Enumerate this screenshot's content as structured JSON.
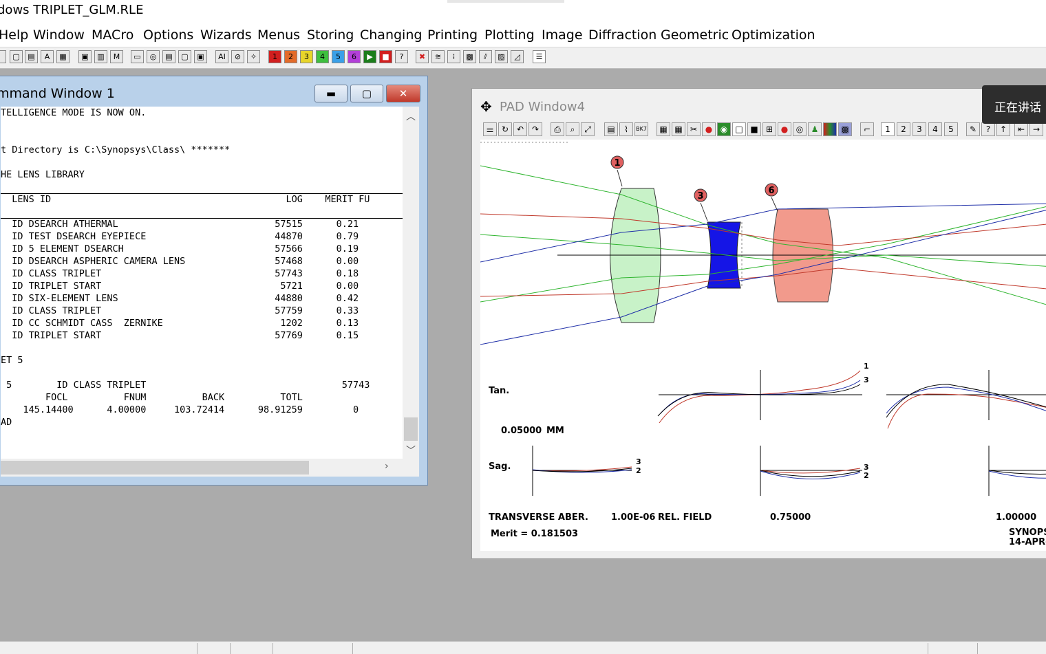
{
  "app": {
    "title": "dows TRIPLET_GLM.RLE"
  },
  "menu": [
    "Help",
    "Window",
    "MACro",
    "Options",
    "Wizards",
    "Menus",
    "Storing",
    "Changing",
    "Printing",
    "Plotting",
    "Image",
    "Diffraction",
    "Geometric",
    "Optimization"
  ],
  "toolbar": {
    "color_buttons": [
      {
        "label": "1",
        "color": "#d21f1f"
      },
      {
        "label": "2",
        "color": "#e36b2a"
      },
      {
        "label": "3",
        "color": "#e8d52a"
      },
      {
        "label": "4",
        "color": "#3fbf3f"
      },
      {
        "label": "5",
        "color": "#3aa0e8"
      },
      {
        "label": "6",
        "color": "#b33fd9"
      }
    ],
    "ai_label": "AI"
  },
  "command_window": {
    "title": "mmand Window 1",
    "lines": [
      "TELLIGENCE MODE IS NOW ON.",
      "",
      "",
      "t Directory is C:\\Synopsys\\Class\\ *******",
      "",
      "HE LENS LIBRARY",
      "",
      "  LENS ID                                          LOG    MERIT FU",
      "",
      "  ID DSEARCH ATHERMAL                            57515      0.21",
      "  ID TEST DSEARCH EYEPIECE                       44870      0.79",
      "  ID 5 ELEMENT DSEARCH                           57566      0.19",
      "  ID DSEARCH ASPHERIC CAMERA LENS                57468      0.00",
      "  ID CLASS TRIPLET                               57743      0.18",
      "  ID TRIPLET START                                5721      0.00",
      "  ID SIX-ELEMENT LENS                            44880      0.42",
      "  ID CLASS TRIPLET                               57759      0.33",
      "  ID CC SCHMIDT CASS  ZERNIKE                     1202      0.13",
      "  ID TRIPLET START                               57769      0.15",
      "",
      "ET 5",
      "",
      " 5        ID CLASS TRIPLET                                   57743",
      "        FOCL          FNUM          BACK          TOTL",
      "    145.14400      4.00000     103.72414      98.91259         0",
      "AD"
    ]
  },
  "pad_window": {
    "title": "PAD Window4",
    "page_buttons": [
      "1",
      "2",
      "3",
      "4",
      "5"
    ],
    "surface_labels": [
      "1",
      "3",
      "6"
    ],
    "aberration": {
      "tan_label": "Tan.",
      "sag_label": "Sag.",
      "scale_value": "0.05000",
      "scale_unit": "MM",
      "curve_labels_tan": [
        "1",
        "3"
      ],
      "curve_labels_sag": [
        "3",
        "2"
      ],
      "footer": {
        "transverse": "TRANSVERSE ABER.",
        "wavelength": "1.00E-06",
        "rel_field": "REL. FIELD",
        "field_mid": "0.75000",
        "field_full": "1.00000",
        "merit": "Merit = 0.181503",
        "brand": "SYNOPS",
        "date": "14-APR-"
      }
    }
  },
  "notification": {
    "text": "正在讲话"
  },
  "colors": {
    "red_ray": "#c0392b",
    "green_ray": "#2fb52f",
    "blue_ray": "#1f2fa8",
    "lens1": "#c8f2c8",
    "lens2": "#1515e6",
    "lens3": "#f29a8c"
  }
}
